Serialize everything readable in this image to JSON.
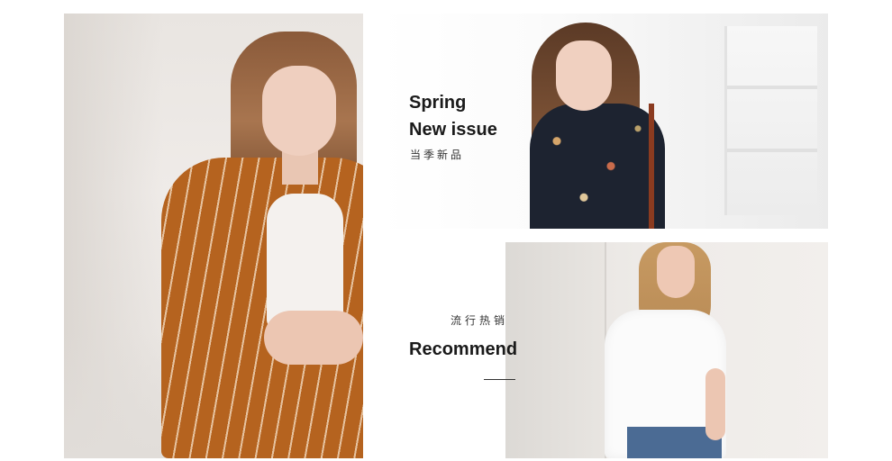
{
  "spring": {
    "title_line1": "Spring",
    "title_line2": "New issue",
    "subtitle": "当季新品"
  },
  "recommend": {
    "subtitle": "流行热销",
    "title": "Recommend"
  }
}
